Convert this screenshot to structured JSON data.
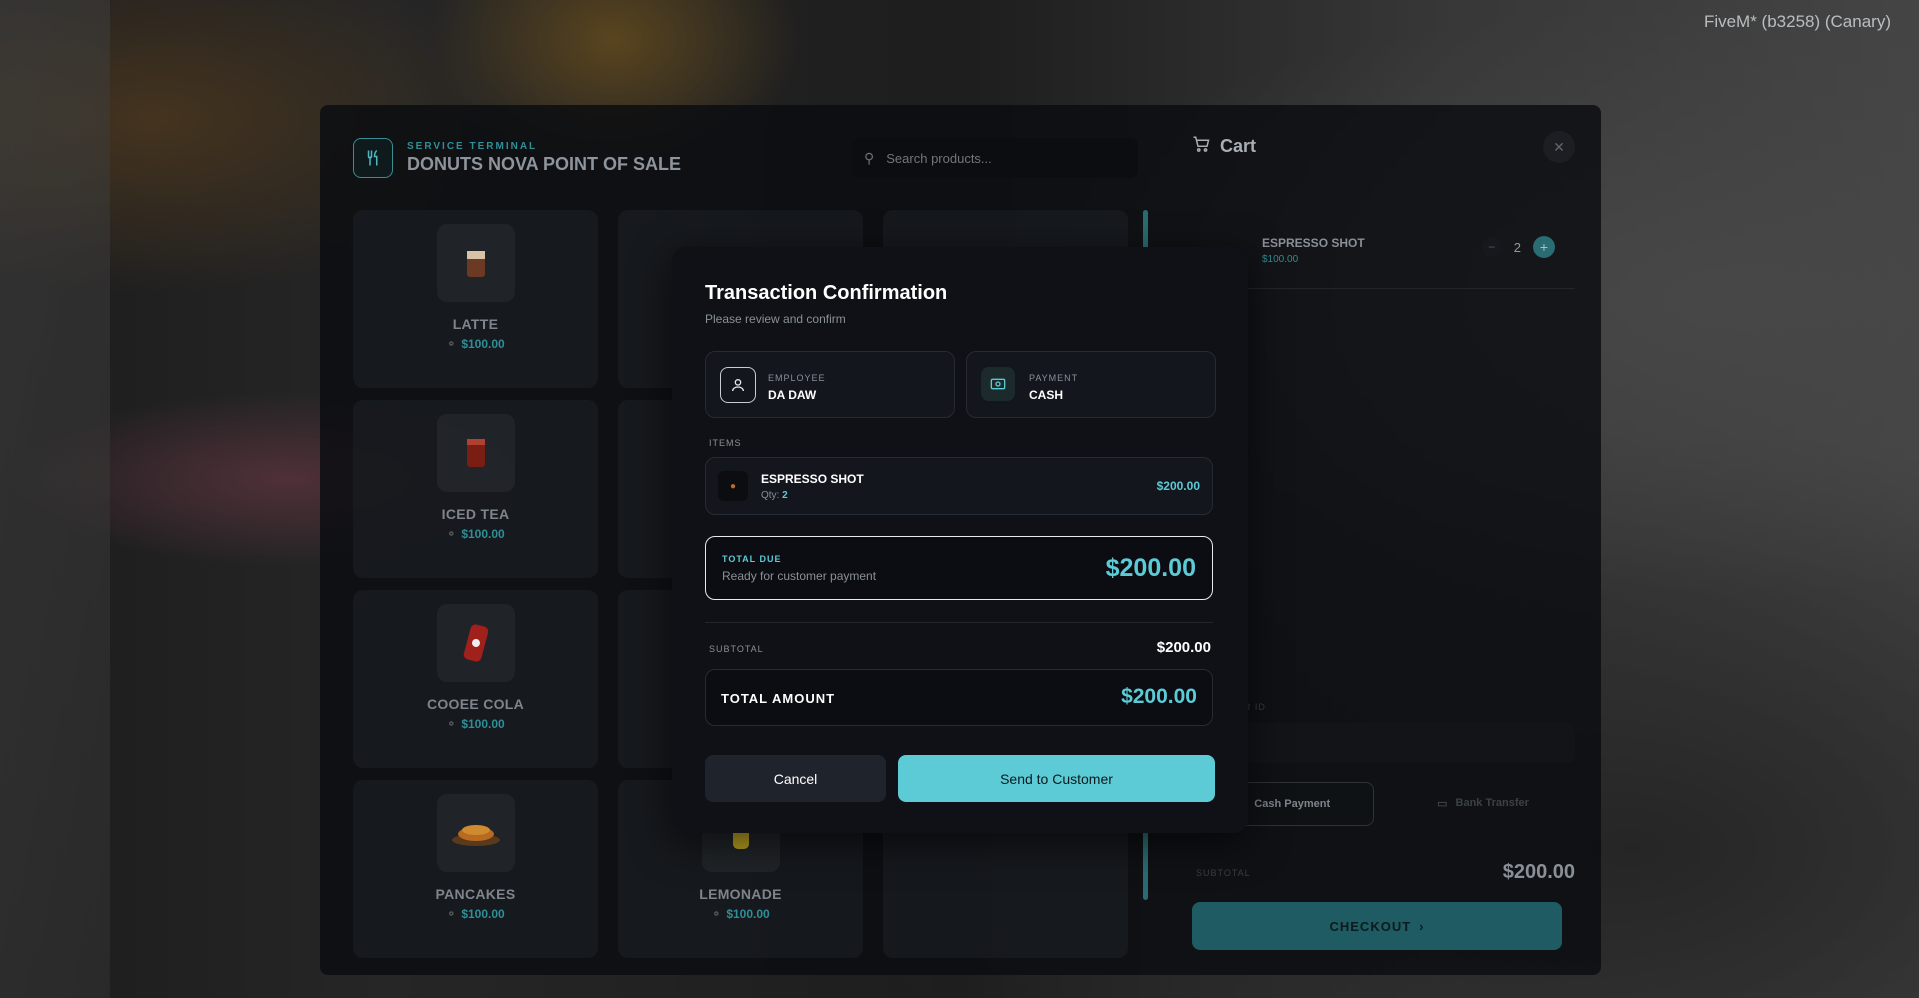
{
  "watermark": "FiveM* (b3258) (Canary)",
  "pos": {
    "subtitle": "SERVICE TERMINAL",
    "title": "DONUTS NOVA POINT OF SALE",
    "search_placeholder": "Search products...",
    "products": [
      {
        "name": "LATTE",
        "price": "$100.00",
        "icon": "latte"
      },
      {
        "name": "ICED TEA",
        "price": "$100.00",
        "icon": "iced-tea"
      },
      {
        "name": "COOEE COLA",
        "price": "$100.00",
        "icon": "cola-can"
      },
      {
        "name": "PANCAKES",
        "price": "$100.00",
        "icon": "pancakes"
      },
      {
        "name": "LEMONADE",
        "price": "$100.00",
        "icon": "lemonade"
      }
    ]
  },
  "cart": {
    "title": "Cart",
    "item": {
      "name": "ESPRESSO SHOT",
      "price": "$100.00",
      "qty": "2"
    },
    "customer_label": "CUSTOMER ID",
    "cash_label": "Cash Payment",
    "bank_label": "Bank Transfer",
    "subtotal_label": "SUBTOTAL",
    "subtotal_value": "$200.00",
    "checkout_label": "CHECKOUT"
  },
  "modal": {
    "title": "Transaction Confirmation",
    "subtitle": "Please review and confirm",
    "employee_label": "EMPLOYEE",
    "employee_value": "DA DAW",
    "payment_label": "PAYMENT",
    "payment_value": "CASH",
    "items_label": "ITEMS",
    "item_name": "ESPRESSO SHOT",
    "item_qty_label": "Qty:",
    "item_qty": "2",
    "item_price": "$200.00",
    "total_due_label": "TOTAL DUE",
    "total_due_sub": "Ready for customer payment",
    "total_due_value": "$200.00",
    "subtotal_label": "SUBTOTAL",
    "subtotal_value": "$200.00",
    "total_amount_label": "TOTAL AMOUNT",
    "total_amount_value": "$200.00",
    "cancel_label": "Cancel",
    "send_label": "Send to Customer"
  },
  "colors": {
    "accent": "#5ccbd6",
    "panel": "#0f1117"
  }
}
